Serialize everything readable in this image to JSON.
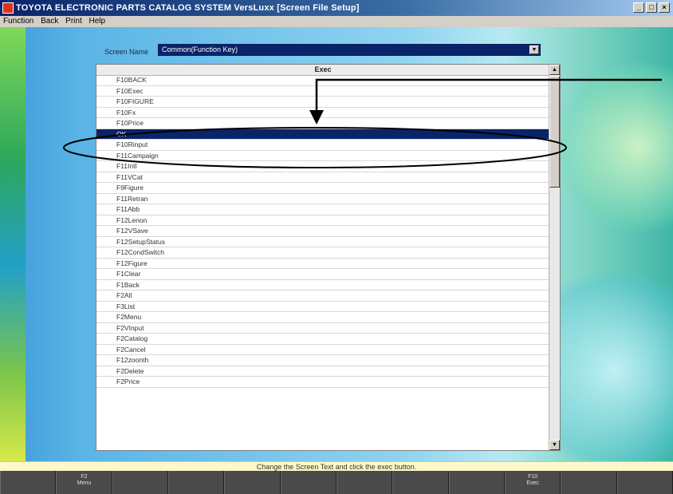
{
  "window": {
    "title": "TOYOTA ELECTRONIC PARTS CATALOG SYSTEM VersLuxx [Screen File Setup]",
    "controls": [
      "_",
      "□",
      "×"
    ]
  },
  "menu": [
    "Function",
    "Back",
    "Print",
    "Help"
  ],
  "screen_name": {
    "label": "Screen Name",
    "value": "Common(Function Key)"
  },
  "list": {
    "header": "Exec",
    "selected_index": 5,
    "rows": [
      "F10BACK",
      "F10Exec",
      "F10FIGURE",
      "F10Fx",
      "F10Price",
      "OK",
      "F10Rinput",
      "F11Campaign",
      "F11Intl",
      "F11VCat",
      "F9Figure",
      "F11Retran",
      "F11Abb",
      "F12Lenon",
      "F12VSave",
      "F12SetupStatus",
      "F12CondSwitch",
      "F12Figure",
      "F1Clear",
      "F1Back",
      "F2All",
      "F3List",
      "F2Menu",
      "F2VInput",
      "F2Catalog",
      "F2Cancel",
      "F12zoonth",
      "F2Delete",
      "F2Price"
    ]
  },
  "status_message": "Change the Screen Text and click the exec button.",
  "function_keys": [
    {
      "key": "",
      "label": ""
    },
    {
      "key": "F2",
      "label": "Menu"
    },
    {
      "key": "",
      "label": ""
    },
    {
      "key": "",
      "label": ""
    },
    {
      "key": "",
      "label": ""
    },
    {
      "key": "",
      "label": ""
    },
    {
      "key": "",
      "label": ""
    },
    {
      "key": "",
      "label": ""
    },
    {
      "key": "",
      "label": ""
    },
    {
      "key": "F10",
      "label": "Exec"
    },
    {
      "key": "",
      "label": ""
    },
    {
      "key": "",
      "label": ""
    }
  ],
  "colors": {
    "selection": "#0a246a",
    "annotation": "#000000",
    "status_bg": "#fff9c8"
  }
}
